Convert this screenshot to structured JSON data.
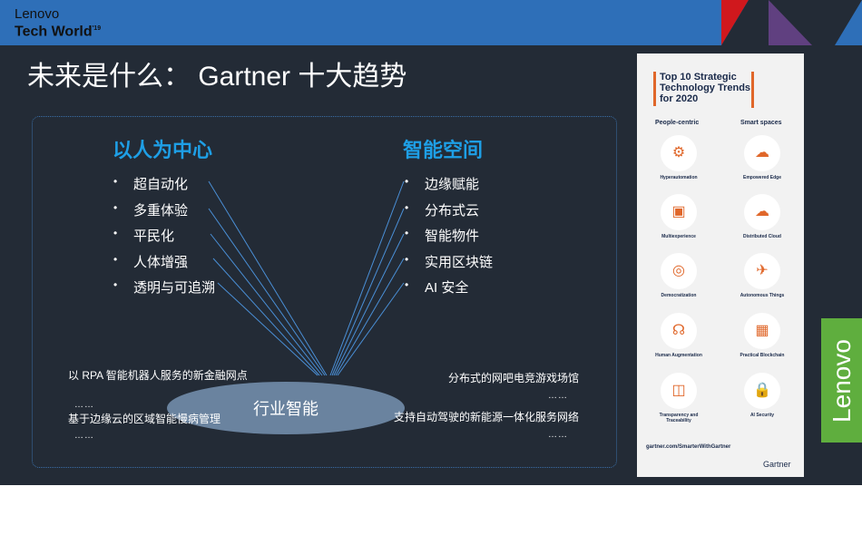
{
  "header": {
    "brand_line1": "Lenovo",
    "brand_line2": "Tech World",
    "brand_sup": "'19"
  },
  "title": "未来是什么： Gartner 十大趋势",
  "left": {
    "heading": "以人为中心",
    "items": [
      "超自动化",
      "多重体验",
      "平民化",
      "人体增强",
      "透明与可追溯"
    ]
  },
  "right": {
    "heading": "智能空间",
    "items": [
      "边缘赋能",
      "分布式云",
      "智能物件",
      "实用区块链",
      "AI 安全"
    ]
  },
  "center": "行业智能",
  "examples": {
    "left": [
      "以 RPA 智能机器人服务的新金融网点",
      "基于边缘云的区域智能慢病管理"
    ],
    "right": [
      "分布式的网吧电竞游戏场馆",
      "支持自动驾驶的新能源一体化服务网络"
    ],
    "ellipsis": "……"
  },
  "poster": {
    "title": "Top 10 Strategic Technology Trends for 2020",
    "col1": "People-centric",
    "col2": "Smart spaces",
    "left_items": [
      "Hyperautomation",
      "Multiexperience",
      "Democratization",
      "Human Augmentation",
      "Transparency and Traceability"
    ],
    "right_items": [
      "Empowered Edge",
      "Distributed Cloud",
      "Autonomous Things",
      "Practical Blockchain",
      "AI Security"
    ],
    "link": "gartner.com/SmarterWithGartner",
    "brand": "Gartner"
  },
  "side_logo": "Lenovo",
  "colors": {
    "header": "#2e6fb8",
    "accent": "#1e9fe6",
    "green": "#5fae3e",
    "orange": "#e0672a"
  }
}
